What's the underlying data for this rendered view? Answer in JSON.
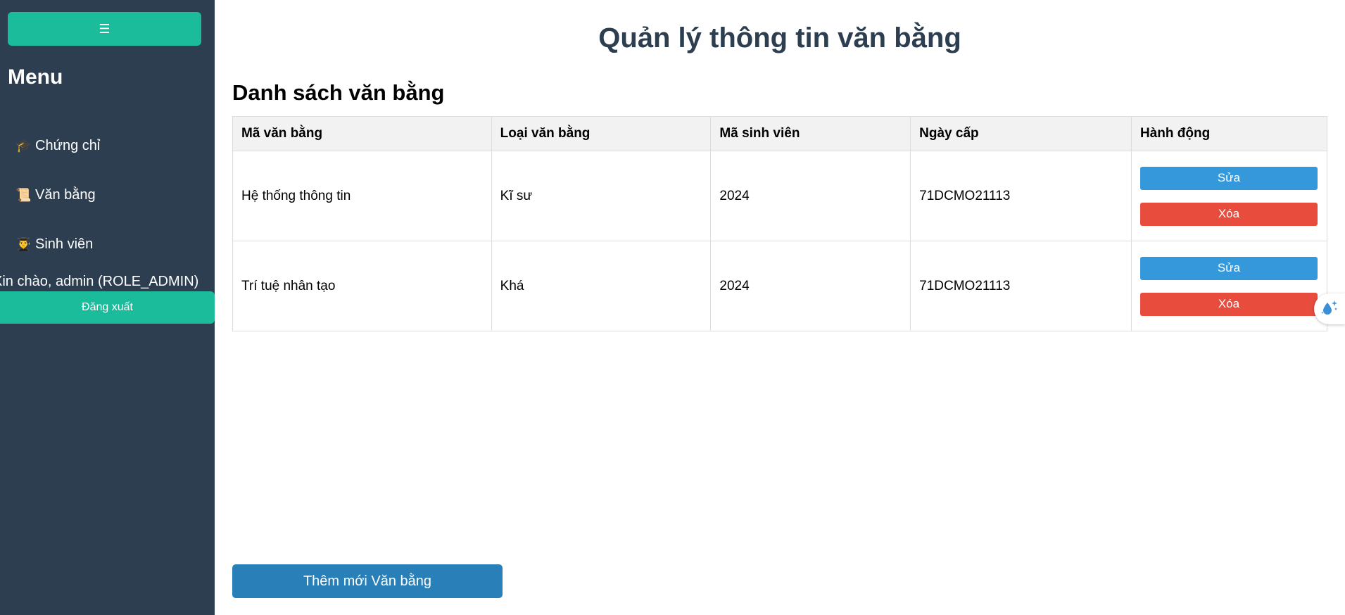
{
  "sidebar": {
    "toggle_icon": "☰",
    "menu_title": "Menu",
    "items": [
      {
        "icon": "🎓",
        "icon_name": "graduation-cap-icon",
        "label": "Chứng chỉ"
      },
      {
        "icon": "📜",
        "icon_name": "scroll-icon",
        "label": "Văn bằng"
      },
      {
        "icon": "👨‍🎓",
        "icon_name": "student-icon",
        "label": "Sinh viên"
      }
    ],
    "greeting": "Xin chào, admin (ROLE_ADMIN)",
    "logout_label": "Đăng xuất"
  },
  "main": {
    "page_title": "Quản lý thông tin văn bằng",
    "section_title": "Danh sách văn bằng",
    "table": {
      "headers": [
        "Mã văn bằng",
        "Loại văn bằng",
        "Mã sinh viên",
        "Ngày cấp",
        "Hành động"
      ],
      "rows": [
        [
          "Hệ thống thông tin",
          "Kĩ sư",
          "2024",
          "71DCMO21113"
        ],
        [
          "Trí tuệ nhân tạo",
          "Khá",
          "2024",
          "71DCMO21113"
        ]
      ],
      "edit_label": "Sửa",
      "delete_label": "Xóa"
    },
    "add_button_label": "Thêm mới Văn bằng"
  },
  "colors": {
    "sidebar_bg": "#2c3e50",
    "accent_teal": "#1abc9c",
    "edit_blue": "#3498db",
    "delete_red": "#e74c3c",
    "add_blue": "#2980b9",
    "title_color": "#2c3e50"
  }
}
